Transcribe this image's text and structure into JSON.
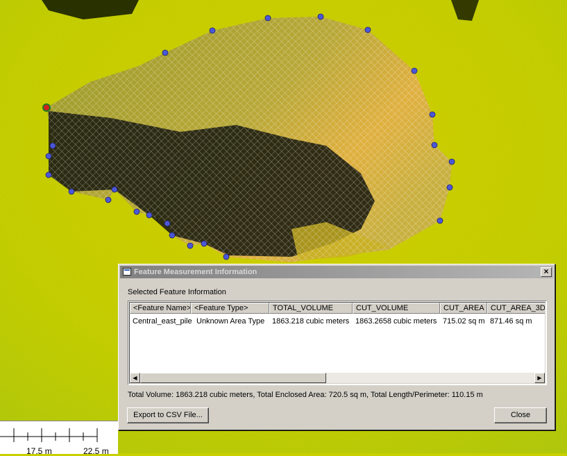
{
  "map": {
    "scale_labels": [
      "17.5 m",
      "22.5 m"
    ]
  },
  "dialog": {
    "title": "Feature Measurement Information",
    "close_glyph": "×",
    "section_label": "Selected Feature Information",
    "columns": [
      "<Feature Name>",
      "<Feature Type>",
      "TOTAL_VOLUME",
      "CUT_VOLUME",
      "CUT_AREA",
      "CUT_AREA_3D"
    ],
    "rows": [
      [
        "Central_east_pile",
        "Unknown Area Type",
        "1863.218 cubic meters",
        "1863.2658 cubic meters",
        "715.02 sq m",
        "871.46 sq m"
      ]
    ],
    "summary": "Total Volume: 1863.218 cubic meters, Total Enclosed Area: 720.5 sq m, Total Length/Perimeter: 110.15 m",
    "export_label": "Export to CSV File...",
    "close_label": "Close",
    "scroll_left": "◀",
    "scroll_right": "▶"
  },
  "colors": {
    "terrain": "#c8d000",
    "dialog_face": "#d4d0c8",
    "vertex": "#4a58d8",
    "start_vertex": "#d02020"
  }
}
